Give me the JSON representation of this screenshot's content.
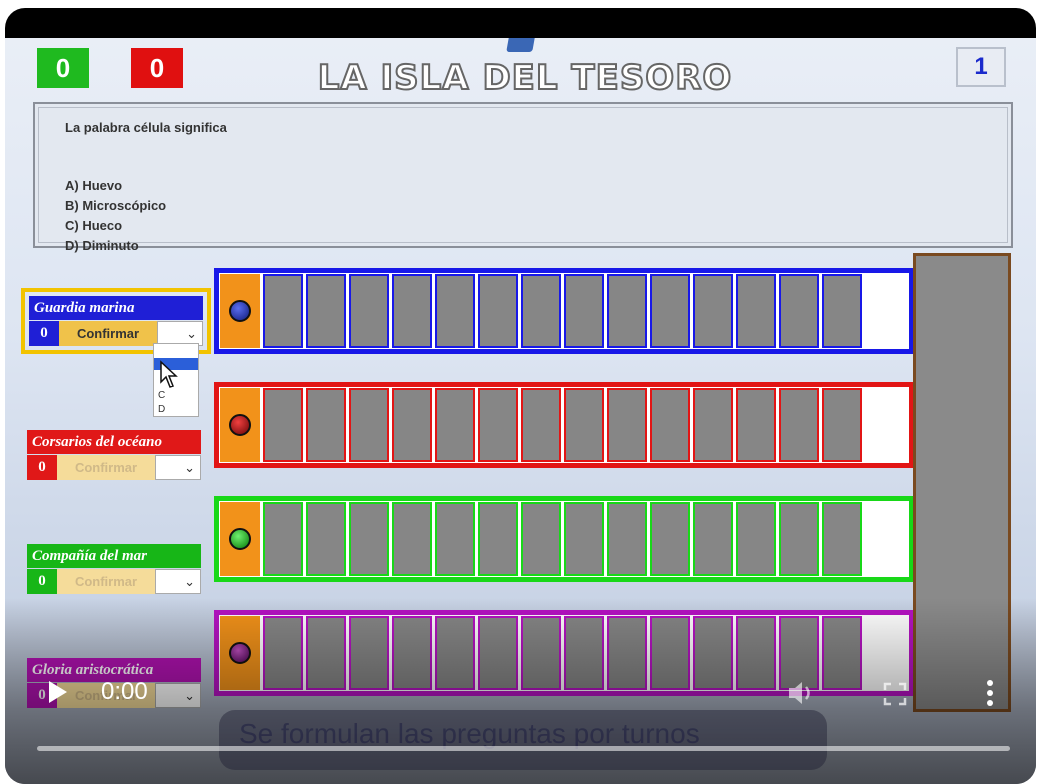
{
  "header": {
    "score_green": "0",
    "score_red": "0",
    "title": "LA ISLA DEL TESORO",
    "round": "1"
  },
  "question": {
    "text": "La palabra célula significa",
    "options": [
      "A) Huevo",
      "B) Microscópico",
      "C) Hueco",
      "D) Diminuto"
    ]
  },
  "teams": [
    {
      "name": "Guardia marina",
      "score": "0",
      "confirm_label": "Confirmar",
      "color": "#1f1fd6",
      "active": true
    },
    {
      "name": "Corsarios del océano",
      "score": "0",
      "confirm_label": "Confirmar",
      "color": "#e01818",
      "active": false
    },
    {
      "name": "Compañía del mar",
      "score": "0",
      "confirm_label": "Confirmar",
      "color": "#17b617",
      "active": false
    },
    {
      "name": "Gloria aristocrática",
      "score": "0",
      "confirm_label": "Confirmar",
      "color": "#b012b0",
      "active": false
    }
  ],
  "dropdown": {
    "options": [
      "C",
      "D"
    ]
  },
  "video": {
    "time": "0:00",
    "caption": "Se formulan las preguntas por turnos"
  }
}
